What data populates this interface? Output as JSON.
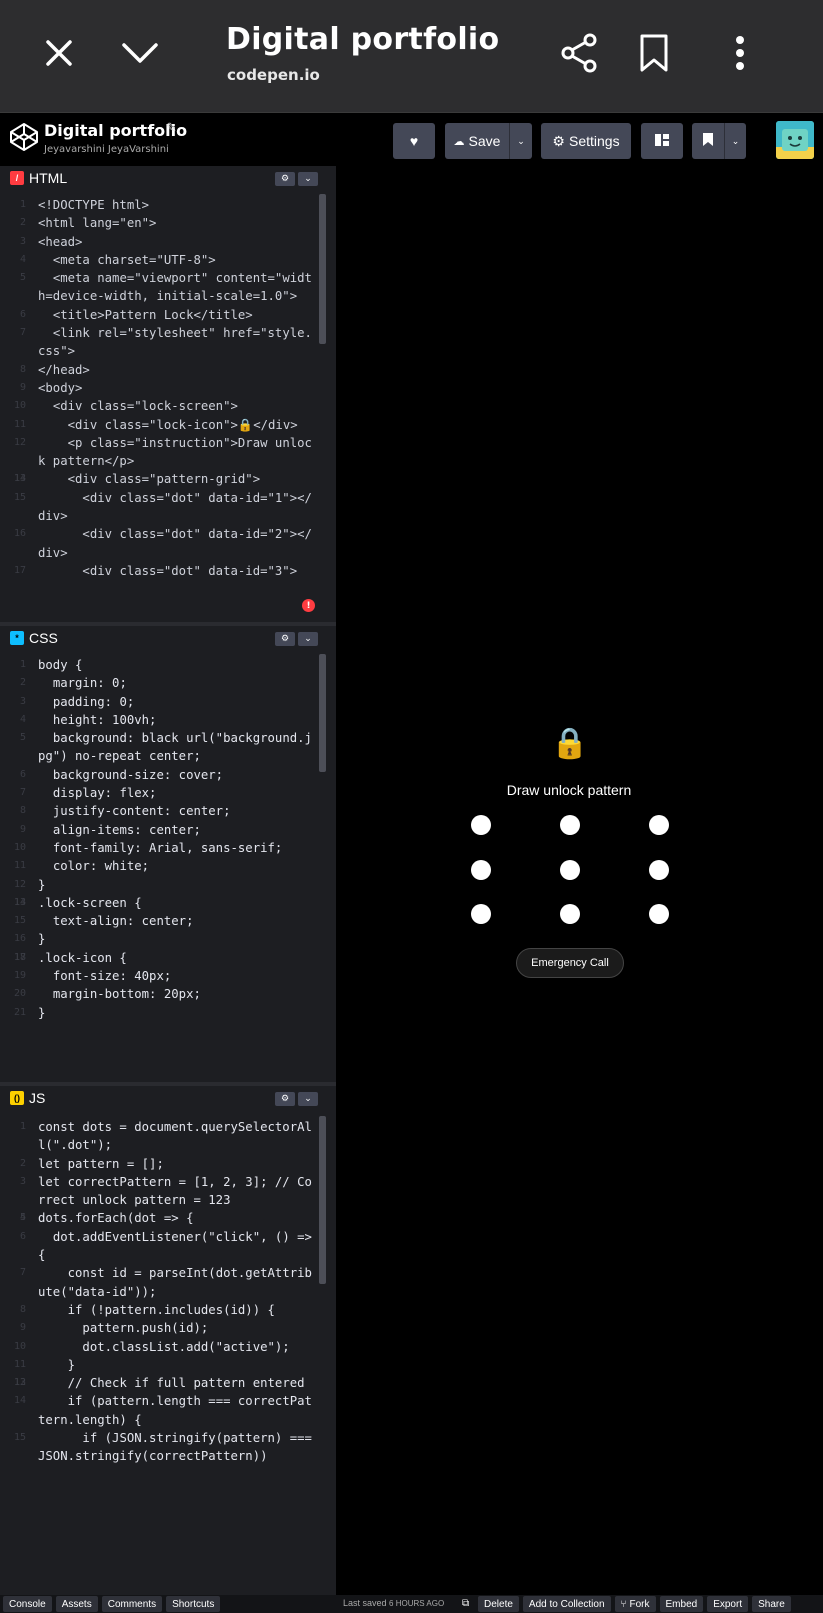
{
  "chrome": {
    "title": "Digital portfolio",
    "url": "codepen.io",
    "icons": [
      "close-icon",
      "chevron-down-icon",
      "share-icon",
      "bookmark-icon",
      "more-vert-icon"
    ]
  },
  "header": {
    "title": "Digital portfolio",
    "author": "Jeyavarshini JeyaVarshini",
    "save_label": "Save",
    "settings_label": "Settings"
  },
  "panes": {
    "html": {
      "label": "HTML",
      "color": "#ff3c41"
    },
    "css": {
      "label": "CSS",
      "color": "#0ebeff"
    },
    "js": {
      "label": "JS",
      "color": "#fcd000"
    }
  },
  "html_code": [
    {
      "n": "1",
      "t": "<!DOCTYPE html>"
    },
    {
      "n": "2",
      "t": "<html lang=\"en\">"
    },
    {
      "n": "3",
      "t": "<head>"
    },
    {
      "n": "4",
      "t": "  <meta charset=\"UTF-8\">"
    },
    {
      "n": "5",
      "t": "  <meta name=\"viewport\" content=\"width=device-width, initial-scale=1.0\">"
    },
    {
      "n": "6",
      "t": "  <title>Pattern Lock</title>"
    },
    {
      "n": "7",
      "t": "  <link rel=\"stylesheet\" href=\"style.css\">"
    },
    {
      "n": "8",
      "t": "</head>"
    },
    {
      "n": "9",
      "t": "<body>"
    },
    {
      "n": "10",
      "t": "  <div class=\"lock-screen\">"
    },
    {
      "n": "11",
      "t": "    <div class=\"lock-icon\">🔒</div>"
    },
    {
      "n": "12",
      "t": "    <p class=\"instruction\">Draw unlock pattern</p>"
    },
    {
      "n": "13",
      "t": ""
    },
    {
      "n": "14",
      "t": "    <div class=\"pattern-grid\">"
    },
    {
      "n": "15",
      "t": "      <div class=\"dot\" data-id=\"1\"></div>"
    },
    {
      "n": "16",
      "t": "      <div class=\"dot\" data-id=\"2\"></div>"
    },
    {
      "n": "17",
      "t": "      <div class=\"dot\" data-id=\"3\">"
    }
  ],
  "css_code": [
    {
      "n": "1",
      "t": "body {"
    },
    {
      "n": "2",
      "t": "  margin: 0;"
    },
    {
      "n": "3",
      "t": "  padding: 0;"
    },
    {
      "n": "4",
      "t": "  height: 100vh;"
    },
    {
      "n": "5",
      "t": "  background: black url(\"background.jpg\") no-repeat center;"
    },
    {
      "n": "6",
      "t": "  background-size: cover;"
    },
    {
      "n": "7",
      "t": "  display: flex;"
    },
    {
      "n": "8",
      "t": "  justify-content: center;"
    },
    {
      "n": "9",
      "t": "  align-items: center;"
    },
    {
      "n": "10",
      "t": "  font-family: Arial, sans-serif;"
    },
    {
      "n": "11",
      "t": "  color: white;"
    },
    {
      "n": "12",
      "t": "}"
    },
    {
      "n": "13",
      "t": ""
    },
    {
      "n": "14",
      "t": ".lock-screen {"
    },
    {
      "n": "15",
      "t": "  text-align: center;"
    },
    {
      "n": "16",
      "t": "}"
    },
    {
      "n": "17",
      "t": ""
    },
    {
      "n": "18",
      "t": ".lock-icon {"
    },
    {
      "n": "19",
      "t": "  font-size: 40px;"
    },
    {
      "n": "20",
      "t": "  margin-bottom: 20px;"
    },
    {
      "n": "21",
      "t": "}"
    }
  ],
  "js_code": [
    {
      "n": "1",
      "t": "const dots = document.querySelectorAll(\".dot\");"
    },
    {
      "n": "2",
      "t": "let pattern = [];"
    },
    {
      "n": "3",
      "t": "let correctPattern = [1, 2, 3]; // Correct unlock pattern = 123"
    },
    {
      "n": "4",
      "t": ""
    },
    {
      "n": "5",
      "t": "dots.forEach(dot => {"
    },
    {
      "n": "6",
      "t": "  dot.addEventListener(\"click\", () => {"
    },
    {
      "n": "7",
      "t": "    const id = parseInt(dot.getAttribute(\"data-id\"));"
    },
    {
      "n": "8",
      "t": "    if (!pattern.includes(id)) {"
    },
    {
      "n": "9",
      "t": "      pattern.push(id);"
    },
    {
      "n": "10",
      "t": "      dot.classList.add(\"active\");"
    },
    {
      "n": "11",
      "t": "    }"
    },
    {
      "n": "12",
      "t": ""
    },
    {
      "n": "13",
      "t": "    // Check if full pattern entered"
    },
    {
      "n": "14",
      "t": "    if (pattern.length === correctPattern.length) {"
    },
    {
      "n": "15",
      "t": "      if (JSON.stringify(pattern) === JSON.stringify(correctPattern))"
    }
  ],
  "preview": {
    "lock_icon": "🔒",
    "instruction": "Draw unlock pattern",
    "emergency_label": "Emergency Call",
    "dot_count": 9
  },
  "footer": {
    "buttons": [
      "Console",
      "Assets",
      "Comments",
      "Shortcuts"
    ],
    "saved_prefix": "Last saved",
    "saved_time": "6 HOURS AGO",
    "right_buttons": [
      "Delete",
      "Add to Collection",
      "Fork",
      "Embed",
      "Export",
      "Share"
    ]
  }
}
